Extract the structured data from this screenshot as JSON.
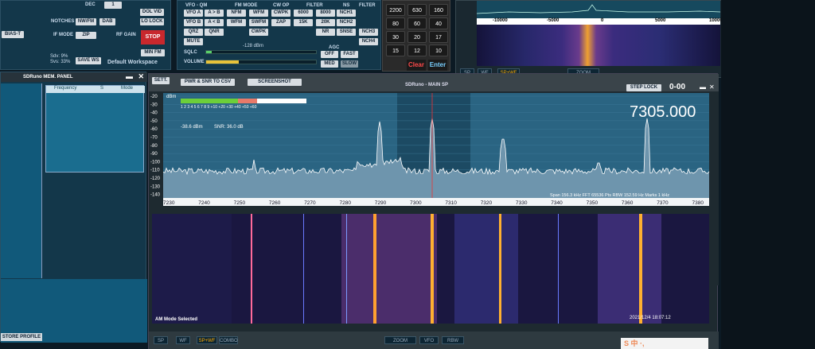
{
  "left_top": {
    "dec_label": "DEC",
    "dec_value": "1",
    "btn_dol_vid": "DOL VID",
    "btn_lo_lock": "LO LOCK",
    "notches_label": "NOTCHES",
    "btn_nw_fm": "NW/FM",
    "btn_dab": "DAB",
    "bias_t": "BIAS-T",
    "if_mode_label": "IF MODE",
    "btn_zip": "ZIP",
    "rf_gain_label": "RF GAIN",
    "stop_label": "STOP",
    "min_fm": "MIN FM",
    "sdv": "Sdv: 9%",
    "svs": "Svs: 33%",
    "save_ws": "SAVE WS",
    "workspace": "Default Workspace"
  },
  "vfo": {
    "vfo_qm": "VFO - QM",
    "fm_mode": "FM MODE",
    "cw_op": "CW OP",
    "filter": "FILTER",
    "ns": "NS",
    "filter_label": "FILTER",
    "row1": [
      "VFO A",
      "A > B",
      "NFM",
      "WFM",
      "CWPK",
      "6000",
      "8000",
      "NCH1"
    ],
    "row2": [
      "VFO B",
      "A < B",
      "WFM",
      "SWFM",
      "ZAP",
      "15K",
      "20K",
      "NCH2"
    ],
    "row3": [
      "QRZ",
      "QNR",
      "",
      "CWPK",
      "",
      "",
      "NR",
      "SNSE",
      "NCH3"
    ],
    "row4": [
      "MUTE",
      "",
      "",
      "",
      "",
      "",
      "",
      "",
      "NCH4"
    ],
    "sqlc": "SQLC",
    "sqlc_val": "-128 dBm",
    "agc": "AGC",
    "agc_off": "OFF",
    "agc_fast": "FAST",
    "agc_slow": "SLOW",
    "volume": "VOLUME",
    "med": "MED"
  },
  "keypad": {
    "keys": [
      "2200",
      "630",
      "160",
      "80",
      "60",
      "40",
      "30",
      "20",
      "17",
      "15",
      "12",
      "10"
    ],
    "clear": "Clear",
    "enter": "Enter"
  },
  "top_spectrum": {
    "ticks": [
      "-10000",
      "-5000",
      "0",
      "5000",
      "10000"
    ],
    "btn_sp": "SP",
    "btn_wf": "WF",
    "btn_spwf": "SP+WF",
    "zoom": "ZOOM"
  },
  "memory": {
    "title": "SDRuno MEM. PANEL",
    "cols": [
      "Frequency",
      "S",
      "Mode"
    ]
  },
  "main": {
    "sett": "SETT.",
    "pwr_csv": "PWR & SNR TO CSV",
    "screenshot": "SCREENSHOT",
    "title": "SDRuno - MAIN SP",
    "step_lock": "STEP LOCK",
    "step_value": "0-00",
    "frequency": "7305.000",
    "dbm_label": "dBm",
    "s_scale": "1 2 3 4 5 6 7 8 9 +10 +20 +30 +40 +50 +60",
    "dbm_reading": "-38.6 dBm",
    "snr_reading": "SNR: 36.0 dB",
    "y_ticks": [
      "-20",
      "-30",
      "-40",
      "-50",
      "-60",
      "-70",
      "-80",
      "-90",
      "-100",
      "-110",
      "-120",
      "-130",
      "-140"
    ],
    "x_ticks": [
      "7230",
      "7240",
      "7250",
      "7260",
      "7270",
      "7280",
      "7290",
      "7300",
      "7310",
      "7320",
      "7330",
      "7340",
      "7350",
      "7360",
      "7370",
      "7380"
    ],
    "info": "Span 156.3 kHz   FFT 65536 Pts   RBW 152.59 Hz   Marks 1 kHz",
    "am_mode": "AM Mode Selected",
    "timestamp": "2021/12/4 18:07:12",
    "btm_sp": "SP",
    "btm_wf": "WF",
    "btm_spwf": "SP+WF",
    "btm_combo": "COMBO",
    "btm_zoom": "ZOOM",
    "btm_vfo": "VFO",
    "btm_rbw": "RBW"
  },
  "store_profile": "STORE PROFILE",
  "ime": "S 中 ·,"
}
